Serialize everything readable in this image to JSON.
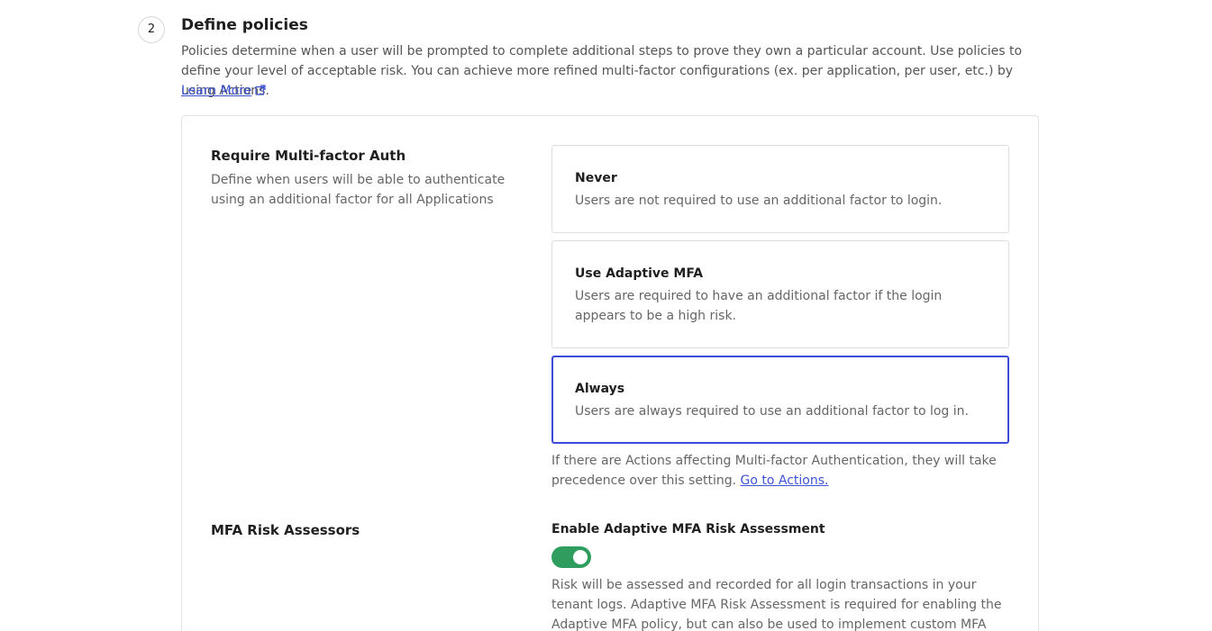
{
  "step": {
    "number": "2",
    "title": "Define policies",
    "description": "Policies determine when a user will be prompted to complete additional steps to prove they own a particular account. Use policies to define your level of acceptable risk. You can achieve more refined multi-factor configurations (ex. per application, per user, etc.) by using Actions.",
    "learn_more": "Learn More"
  },
  "mfa_policy": {
    "title": "Require Multi-factor Auth",
    "description": "Define when users will be able to authenticate using an additional factor for all Applications",
    "options": [
      {
        "title": "Never",
        "description": "Users are not required to use an additional factor to login.",
        "selected": false
      },
      {
        "title": "Use Adaptive MFA",
        "description": "Users are required to have an additional factor if the login appears to be a high risk.",
        "selected": false
      },
      {
        "title": "Always",
        "description": "Users are always required to use an additional factor to log in.",
        "selected": true
      }
    ],
    "actions_note": "If there are Actions affecting Multi-factor Authentication, they will take precedence over this setting.",
    "actions_link": "Go to Actions."
  },
  "risk_assessors": {
    "title": "MFA Risk Assessors",
    "toggle_label": "Enable Adaptive MFA Risk Assessment",
    "toggle_on": true,
    "toggle_description": "Risk will be assessed and recorded for all login transactions in your tenant logs. Adaptive MFA Risk Assessment is required for enabling the Adaptive MFA policy, but can also be used to implement custom MFA policies using"
  },
  "colors": {
    "accent": "#3b4bd6",
    "link": "#3d53d6",
    "toggle_on": "#2e9d5e"
  }
}
